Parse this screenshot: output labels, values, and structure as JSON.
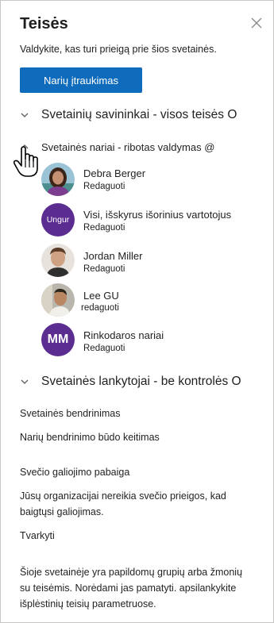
{
  "panel": {
    "title": "Teisės",
    "description": "Valdykite, kas turi prieigą prie šios svetainės."
  },
  "invite_button": "Narių įtraukimas",
  "sections": {
    "owners": "Svetainių savininkai - visos teisės O",
    "members": "Svetainės nariai - ribotas valdymas @",
    "visitors": "Svetainės lankytojai - be kontrolės O"
  },
  "members": [
    {
      "name": "Debra Berger",
      "role": "Redaguoti"
    },
    {
      "name": "Visi, išskyrus išorinius vartotojus",
      "role": "Redaguoti",
      "initials": "Ungur"
    },
    {
      "name": "Jordan Miller",
      "role": "Redaguoti"
    },
    {
      "name": "Lee GU",
      "role": "redaguoti"
    },
    {
      "name": "Rinkodaros nariai",
      "role": "Redaguoti",
      "initials": "MM"
    }
  ],
  "sharing": {
    "heading": "Svetainės bendrinimas",
    "link": "Narių bendrinimo būdo keitimas"
  },
  "guest": {
    "heading": "Svečio galiojimo pabaiga",
    "text": "Jūsų organizacijai nereikia svečio prieigos, kad baigtųsi galiojimas.",
    "link": "Tvarkyti"
  },
  "footer_note": "Šioje svetainėje yra papildomų grupių arba žmonių su teisėmis. Norėdami jas pamatyti. apsilankykite išplėstinių teisių parametruose.",
  "colors": {
    "accent": "#0f6cbd",
    "purple": "#5c2d91"
  }
}
